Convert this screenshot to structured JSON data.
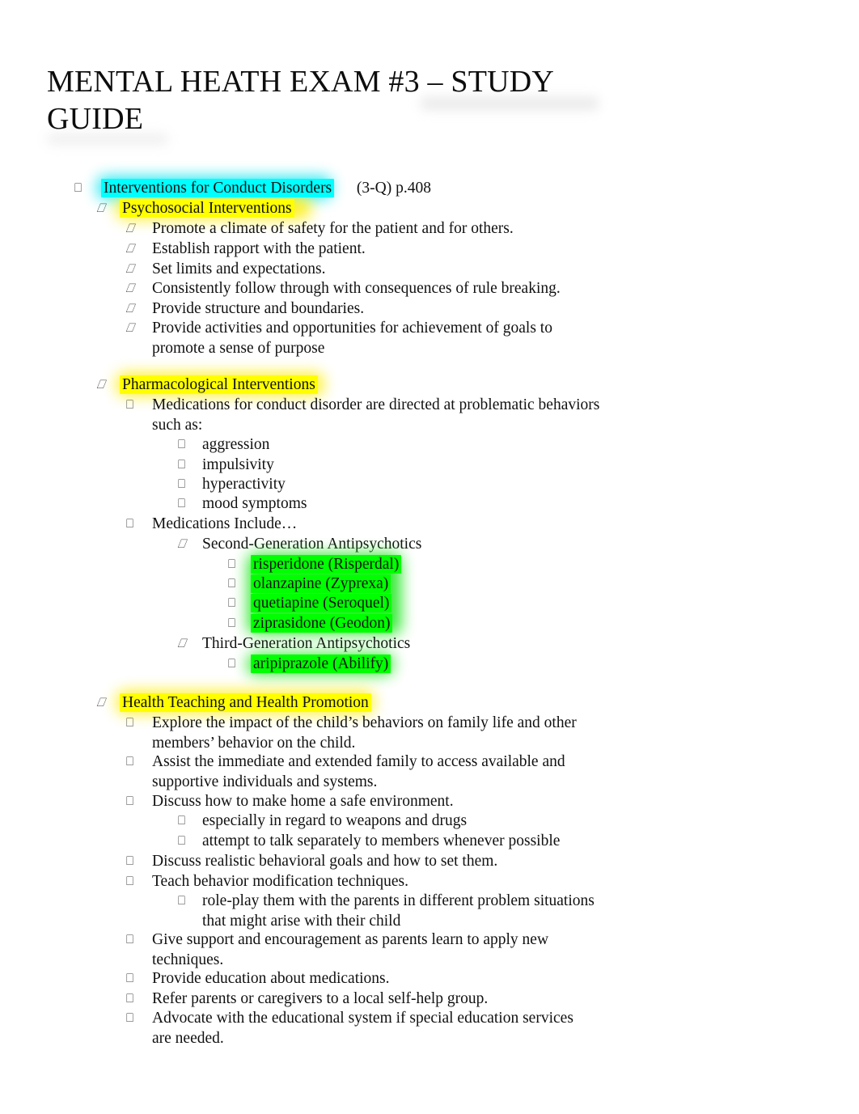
{
  "document": {
    "title": "MENTAL HEATH EXAM #3 – STUDY GUIDE",
    "title_line_1": "MENTAL HEATH EXAM #3 – STUDY",
    "title_line_2": "GUIDE"
  },
  "colors": {
    "highlight_cyan": "#00FFFF",
    "highlight_yellow": "#FFFF00",
    "highlight_green": "#00FF00",
    "text": "#000000",
    "page_background": "#FFFFFF"
  },
  "bullet_glyph": "⎕",
  "outline": {
    "heading": {
      "label": "Interventions for Conduct Disorders",
      "reference": "(3-Q) p.408",
      "highlight": "cyan"
    },
    "sections": [
      {
        "label": "Psychosocial Interventions",
        "highlight": "yellow",
        "items": [
          "Promote a climate of safety for the patient and for others.",
          "Establish rapport with the patient.",
          "Set limits and expectations.",
          "Consistently follow through with consequences of rule breaking.",
          "Provide structure and boundaries.",
          "Provide activities and opportunities for achievement of goals to promote a sense of purpose"
        ]
      },
      {
        "label": "Pharmacological Interventions",
        "highlight": "yellow",
        "intro": "Medications for conduct disorder are directed at problematic behaviors such as:",
        "targets": [
          "aggression",
          "impulsivity",
          "hyperactivity",
          "mood symptoms"
        ],
        "medications_label": "Medications Include…",
        "drug_classes": [
          {
            "class_name": "Second-Generation Antipsychotics",
            "drugs": [
              "risperidone (Risperdal)",
              "olanzapine (Zyprexa)",
              "quetiapine (Seroquel)",
              "ziprasidone (Geodon)"
            ]
          },
          {
            "class_name": "Third-Generation Antipsychotics",
            "drugs": [
              "aripiprazole (Abilify)"
            ]
          }
        ]
      },
      {
        "label": "Health Teaching and Health Promotion",
        "highlight": "yellow",
        "items": [
          {
            "text": "Explore the impact of the child’s behaviors on family life and other members’ behavior on the child.",
            "sub": []
          },
          {
            "text": "Assist the immediate and extended family to access available and supportive individuals and systems.",
            "sub": []
          },
          {
            "text": "Discuss how to make home a safe environment.",
            "sub": [
              "especially in regard to weapons and drugs",
              "attempt to talk separately to members whenever possible"
            ]
          },
          {
            "text": "Discuss realistic behavioral goals and how to set them.",
            "sub": []
          },
          {
            "text": "Teach behavior modification techniques.",
            "sub": [
              "role-play them with the parents in different problem situations that might arise with their child"
            ]
          },
          {
            "text": "Give support and encouragement as parents learn to apply new techniques.",
            "sub": []
          },
          {
            "text": "Provide education about medications.",
            "sub": []
          },
          {
            "text": "Refer parents or caregivers to a local self-help group.",
            "sub": []
          },
          {
            "text": "Advocate with the educational system if special education services are needed.",
            "sub": []
          }
        ]
      }
    ]
  }
}
